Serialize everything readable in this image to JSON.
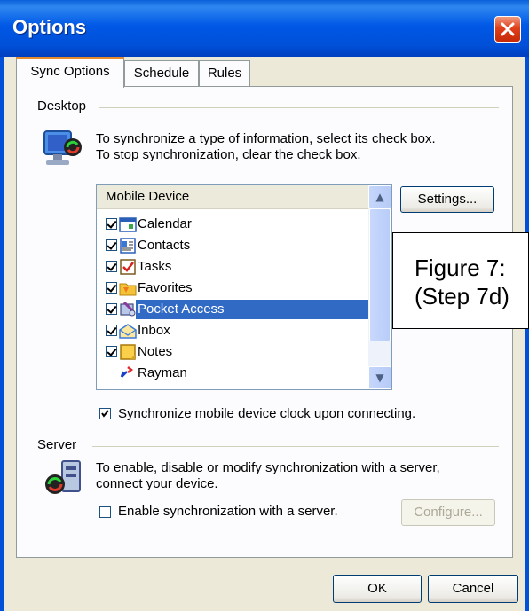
{
  "window": {
    "title": "Options"
  },
  "tabs": [
    {
      "label": "Sync Options",
      "active": true
    },
    {
      "label": "Schedule",
      "active": false
    },
    {
      "label": "Rules",
      "active": false
    }
  ],
  "desktop": {
    "heading": "Desktop",
    "desc_line1": "To synchronize a type of information, select its check box.",
    "desc_line2": "To stop synchronization, clear the check box.",
    "list_header": "Mobile Device",
    "settings_button": "Settings...",
    "items": [
      {
        "label": "Calendar",
        "checked": true,
        "icon": "calendar-icon"
      },
      {
        "label": "Contacts",
        "checked": true,
        "icon": "contacts-icon"
      },
      {
        "label": "Tasks",
        "checked": true,
        "icon": "tasks-icon"
      },
      {
        "label": "Favorites",
        "checked": true,
        "icon": "favorites-icon"
      },
      {
        "label": "Pocket Access",
        "checked": true,
        "icon": "pocket-access-icon",
        "selected": true
      },
      {
        "label": "Inbox",
        "checked": true,
        "icon": "inbox-icon"
      },
      {
        "label": "Notes",
        "checked": true,
        "icon": "notes-icon"
      },
      {
        "label": "Rayman",
        "checked": false,
        "icon": "rayman-icon"
      }
    ],
    "clock_sync": {
      "label": "Synchronize mobile device clock upon connecting.",
      "checked": true
    }
  },
  "server": {
    "heading": "Server",
    "desc_line1": "To enable, disable or modify synchronization with a server,",
    "desc_line2": "connect your device.",
    "enable": {
      "label": "Enable synchronization with a server.",
      "checked": false
    },
    "configure_button": "Configure..."
  },
  "footer": {
    "ok": "OK",
    "cancel": "Cancel"
  },
  "annotation": {
    "line1": "Figure 7:",
    "line2": "(Step 7d)"
  },
  "colors": {
    "titlebar": "#0054e3",
    "selection": "#316ac5",
    "dialog_bg": "#ece9d8",
    "close": "#e0401a"
  }
}
